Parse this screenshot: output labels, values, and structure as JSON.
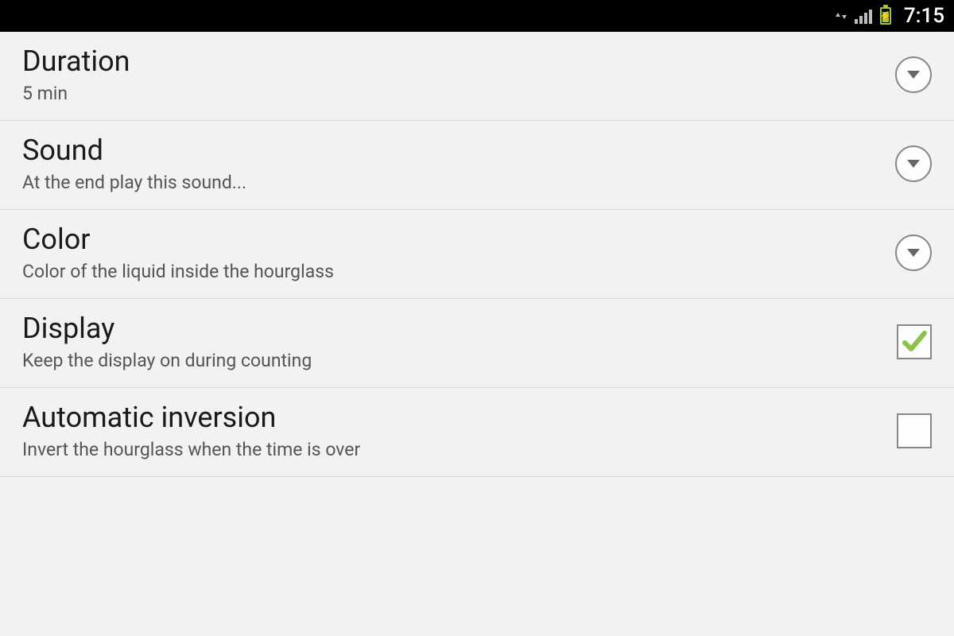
{
  "status": {
    "time": "7:15"
  },
  "settings": {
    "duration": {
      "title": "Duration",
      "subtitle": "5 min"
    },
    "sound": {
      "title": "Sound",
      "subtitle": "At the end play this sound..."
    },
    "color": {
      "title": "Color",
      "subtitle": "Color of the liquid inside the hourglass"
    },
    "display": {
      "title": "Display",
      "subtitle": "Keep the display on during counting",
      "checked": true
    },
    "autoinvert": {
      "title": "Automatic inversion",
      "subtitle": "Invert the hourglass when the time is over",
      "checked": false
    }
  }
}
